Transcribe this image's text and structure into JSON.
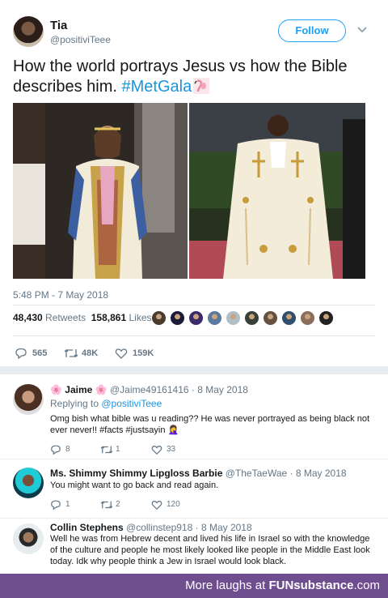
{
  "main_tweet": {
    "author_name": "Tia",
    "author_handle": "@positiviTeee",
    "follow_label": "Follow",
    "text_main": "How the world portrays Jesus vs how the Bible describes him. ",
    "hashtag": "#MetGala",
    "timestamp": "5:48 PM - 7 May 2018",
    "retweets_count": "48,430",
    "retweets_label": "Retweets",
    "likes_count": "158,861",
    "likes_label": "Likes",
    "replies": "565",
    "retweets_short": "48K",
    "likes_short": "159K",
    "liker_colors": [
      "#4a3b2f",
      "#1d1b3a",
      "#3c2a6b",
      "#5a7aa0",
      "#b0bec5",
      "#38403a",
      "#65513f",
      "#2f4f6f",
      "#8a6d5a",
      "#222"
    ]
  },
  "replies": [
    {
      "name": "Jaime",
      "handle": "@Jaime49161416",
      "date": "· 8 May 2018",
      "replying_prefix": "Replying to ",
      "replying_to": "@positiviTeee",
      "text": "Omg bish what bible was u reading?? He was never portrayed as being black not ever never!! #facts #justsayin 🤦‍♀️",
      "comments": "8",
      "retweets": "1",
      "likes": "33"
    },
    {
      "name": "Ms. Shimmy Shimmy Lipgloss Barbie",
      "handle": "@TheTaeWae",
      "date": "· 8 May 2018",
      "text": "You might want to go back and read again.",
      "comments": "1",
      "retweets": "2",
      "likes": "120"
    },
    {
      "name": "Collin Stephens",
      "handle": "@collinstep918",
      "date": "· 8 May 2018",
      "text": "Well he was from Hebrew decent and lived his life in Israel so with the knowledge of the culture and people he most likely looked like people in the Middle East look today. Idk why people think a Jew in Israel would look black."
    }
  ],
  "footer": {
    "prefix": "More laughs at ",
    "brand": "FUNsubstance",
    "suffix": ".com"
  },
  "colors": {
    "accent": "#1da1f2",
    "hashtag": "#1b95e0",
    "muted": "#657786",
    "footer_bg": "#6e4e8f"
  }
}
